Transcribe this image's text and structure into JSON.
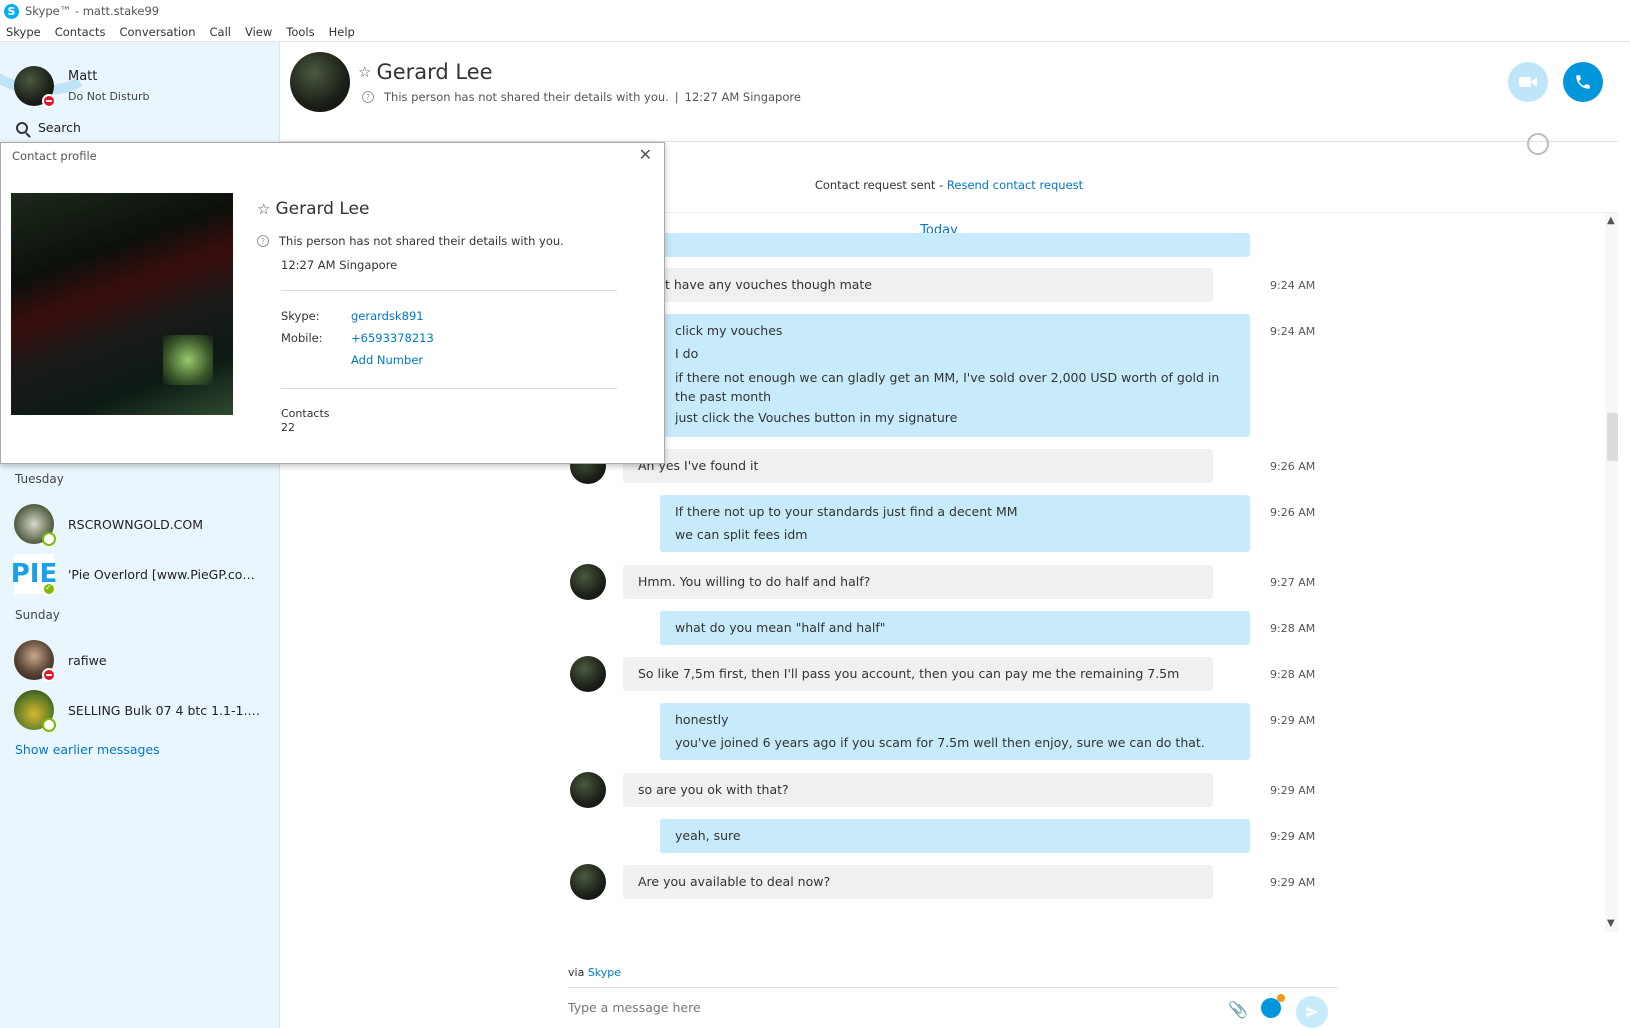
{
  "window": {
    "title": "Skype™ - matt.stake99"
  },
  "menu": [
    "Skype",
    "Contacts",
    "Conversation",
    "Call",
    "View",
    "Tools",
    "Help"
  ],
  "me": {
    "name": "Matt",
    "status": "Do Not Disturb"
  },
  "search": {
    "label": "Search"
  },
  "recents": {
    "groups": [
      {
        "label": "Tuesday"
      },
      {
        "label": "Sunday"
      }
    ],
    "items": [
      {
        "name": "RSCROWNGOLD.COM"
      },
      {
        "name": "'Pie Overlord [www.PieGP.com f..."
      },
      {
        "name": "rafiwe"
      },
      {
        "name": "SELLING Bulk 07 4 btc 1.1-1.15"
      }
    ],
    "show_earlier": "Show earlier messages"
  },
  "conversation": {
    "name": "Gerard Lee",
    "subtitle": "This person has not shared their details with you.",
    "separator": "|",
    "local_time": "12:27 AM Singapore",
    "contact_request": "Contact request sent - ",
    "resend": "Resend contact request",
    "today": "Today"
  },
  "messages": [
    {
      "dir": "in",
      "lines": [
        "don't have any vouches though mate"
      ],
      "time": "9:24 AM"
    },
    {
      "dir": "out",
      "lines": [
        "click my vouches",
        "I do",
        "if there not enough we can gladly get an MM, I've sold over 2,000 USD worth of gold in the past month",
        "just click the Vouches button in my signature"
      ],
      "time": "9:24 AM"
    },
    {
      "dir": "in",
      "lines": [
        "Ah yes I've found it"
      ],
      "time": "9:26 AM"
    },
    {
      "dir": "out",
      "lines": [
        "If there not up to your standards just find a decent MM",
        "we can split fees idm"
      ],
      "time": "9:26 AM"
    },
    {
      "dir": "in",
      "lines": [
        "Hmm. You willing to do half and half?"
      ],
      "time": "9:27 AM"
    },
    {
      "dir": "out",
      "lines": [
        "what do you mean \"half and half\""
      ],
      "time": "9:28 AM"
    },
    {
      "dir": "in",
      "lines": [
        "So like 7,5m first, then I'll pass you account, then you can pay me the remaining 7.5m"
      ],
      "time": "9:28 AM"
    },
    {
      "dir": "out",
      "lines": [
        "honestly",
        "you've joined 6 years ago if you scam for 7.5m well then enjoy, sure we can do that."
      ],
      "time": "9:29 AM"
    },
    {
      "dir": "in",
      "lines": [
        "so are you ok with that?"
      ],
      "time": "9:29 AM"
    },
    {
      "dir": "out",
      "lines": [
        "yeah, sure"
      ],
      "time": "9:29 AM"
    },
    {
      "dir": "in",
      "lines": [
        "Are you available to deal now?"
      ],
      "time": "9:29 AM"
    }
  ],
  "composer": {
    "via": "via ",
    "via_link": "Skype",
    "placeholder": "Type a message here"
  },
  "profile": {
    "title": "Contact profile",
    "name": "Gerard Lee",
    "subtitle": "This person has not shared their details with you.",
    "local_time": "12:27 AM Singapore",
    "skype_label": "Skype:",
    "skype_value": "gerardsk891",
    "mobile_label": "Mobile:",
    "mobile_value": "+6593378213",
    "add_number": "Add Number",
    "contacts_label": "Contacts",
    "contacts_value": "22"
  },
  "colors": {
    "accent": "#0096dc",
    "outgoing": "#c7ebfa",
    "incoming": "#f0f0f2",
    "sidebar": "#eaf6fd",
    "link": "#0078c8"
  }
}
